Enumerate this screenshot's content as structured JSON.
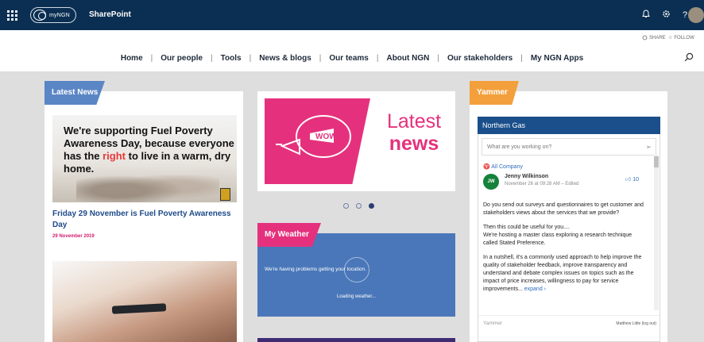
{
  "suitebar": {
    "logo_text": "myNGN",
    "app_name": "SharePoint",
    "icons": [
      "waffle-icon",
      "bell-icon",
      "gear-icon",
      "help-icon"
    ],
    "help_label": "?",
    "color": "#0b2f52"
  },
  "actions": {
    "share_label": "SHARE",
    "follow_label": "FOLLOW"
  },
  "nav": {
    "items": [
      "Home",
      "Our people",
      "Tools",
      "News & blogs",
      "Our teams",
      "About NGN",
      "Our stakeholders",
      "My NGN Apps"
    ],
    "separator": "|"
  },
  "news": {
    "tag": "Latest News",
    "tag_color": "#5b86c5",
    "image_text_before": "We're supporting Fuel Poverty Awareness Day, because everyone has the ",
    "image_text_highlight": "right",
    "image_text_after": " to live in a warm, dry home.",
    "title": "Friday 29 November is Fuel Poverty Awareness Day",
    "date": "29 November 2019"
  },
  "banner": {
    "line1": "Latest",
    "line2": "news",
    "badge": "WOW!"
  },
  "carousel": {
    "count": 3,
    "active": 3
  },
  "weather": {
    "tag": "My Weather",
    "tag_color": "#e5317d",
    "message": "We're having problems getting your location.",
    "loading": "Loading weather..."
  },
  "yammer": {
    "tag": "Yammer",
    "tag_color": "#f3a03c",
    "group_title": "Northern Gas",
    "input_placeholder": "What are you working on?",
    "group_link": "All Company",
    "post": {
      "initials": "JW",
      "author": "Jenny Wilkinson",
      "time": "November 26 at 09:28 AM – Edited",
      "likes": "10",
      "para1": "Do you send out surveys and questionnaires to get customer and stakeholders views about the services that we provide?",
      "para2a": "Then this could be useful for you....",
      "para2b": "We're hosting a master class exploring a research technique called Stated Preference.",
      "para3": "In a nutshell, it's a commonly used approach to help improve the quality of stakeholder feedback, improve transparency and understand and debate complex issues on topics such as the impact of price increases, willingness to pay for service improvements...",
      "expand": "expand ›"
    },
    "footer_label": "Yammer",
    "footer_user": "Matthew Little (log out)"
  }
}
